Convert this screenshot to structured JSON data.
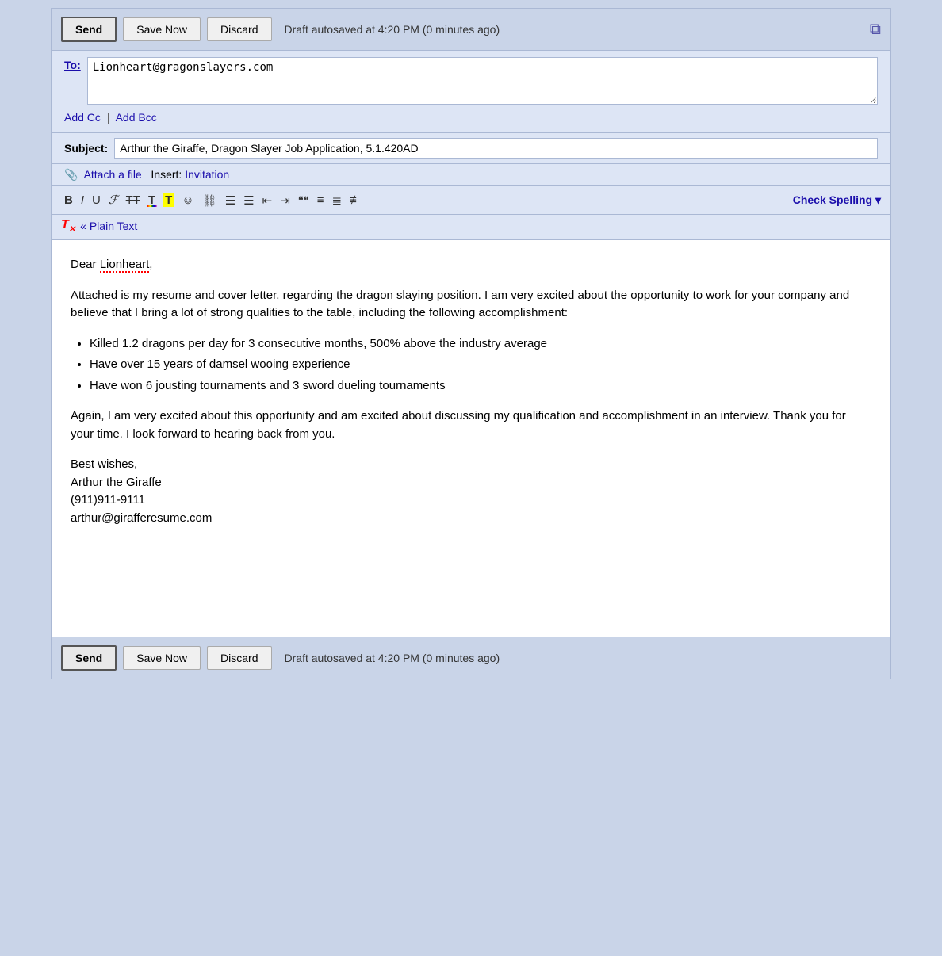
{
  "toolbar": {
    "send_label": "Send",
    "save_now_label": "Save Now",
    "discard_label": "Discard",
    "autosave_text": "Draft autosaved at 4:20 PM (0 minutes ago)",
    "expand_icon": "⧉"
  },
  "recipients": {
    "to_label": "To:",
    "to_value": "Lionheart@gragonslayers.com",
    "add_cc_label": "Add Cc",
    "separator": "|",
    "add_bcc_label": "Add Bcc"
  },
  "subject": {
    "label": "Subject:",
    "value": "Arthur the Giraffe, Dragon Slayer Job Application, 5.1.420AD"
  },
  "attach": {
    "attach_label": "Attach a file",
    "insert_label": "Insert:",
    "invitation_label": "Invitation"
  },
  "format_toolbar": {
    "bold": "B",
    "italic": "I",
    "underline": "U",
    "font": "𝓕",
    "strikethrough": "T̶T̶",
    "font_color": "T",
    "highlight": "T",
    "smiley": "☺",
    "link": "🔗",
    "ordered_list": "≡",
    "unordered_list": "≡",
    "indent_less": "⇐",
    "indent_more": "⇒",
    "quote": "❝❝",
    "align_left": "≡",
    "align_center": "≡",
    "align_right": "≡",
    "check_spelling": "Check Spelling ▾"
  },
  "plain_text": {
    "link_label": "« Plain Text",
    "tx_icon": "T"
  },
  "body": {
    "greeting": "Dear Lionheart,",
    "para1": "Attached is my resume and cover letter, regarding the dragon slaying position.  I am very excited about the opportunity to work for your company and believe that I bring a lot of strong qualities to the table, including the following accomplishment:",
    "bullets": [
      "Killed 1.2 dragons per day for 3 consecutive months, 500% above the industry average",
      "Have over 15 years of damsel wooing experience",
      "Have won 6 jousting tournaments and 3 sword dueling tournaments"
    ],
    "para2": "Again, I am very excited about this opportunity and am excited about discussing my qualification and accomplishment in an interview.  Thank you for your time.  I look forward to hearing back from you.",
    "signature": "Best wishes,\nArthur the Giraffe\n(911)911-9111\narthur@girafferesume.com"
  }
}
